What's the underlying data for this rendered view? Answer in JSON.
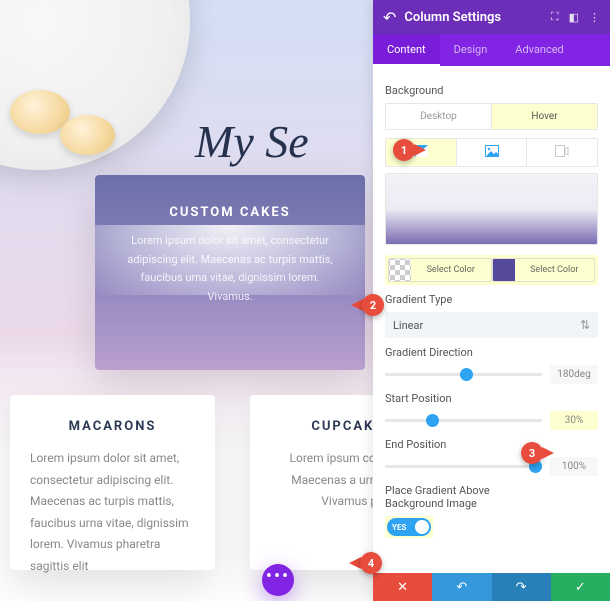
{
  "page": {
    "heading": "My Se",
    "cards": {
      "custom_cakes": {
        "title": "CUSTOM CAKES",
        "body": "Lorem ipsum dolor sit amet, consectetur adipiscing elit. Maecenas ac turpis mattis, faucibus urna vitae, dignissim lorem. Vivamus."
      },
      "macarons": {
        "title": "MACARONS",
        "body": "Lorem ipsum dolor sit amet, consectetur adipiscing elit. Maecenas ac turpis mattis, faucibus urna vitae, dignissim lorem. Vivamus pharetra sagittis elit"
      },
      "cupcakes": {
        "title": "CUPCAKES",
        "body": "Lorem ipsum consectet Maecenas a urna vitae, Vivamus ph"
      }
    },
    "fab": "•••"
  },
  "panel": {
    "title": "Column Settings",
    "tabs": {
      "content": "Content",
      "design": "Design",
      "advanced": "Advanced"
    },
    "background_label": "Background",
    "device_tabs": {
      "desktop": "Desktop",
      "hover": "Hover"
    },
    "select_color": "Select Color",
    "gradient_type": {
      "label": "Gradient Type",
      "value": "Linear"
    },
    "gradient_direction": {
      "label": "Gradient Direction",
      "value": "180deg"
    },
    "start_position": {
      "label": "Start Position",
      "value": "30%"
    },
    "end_position": {
      "label": "End Position",
      "value": "100%"
    },
    "place_above": {
      "label1": "Place Gradient Above",
      "label2": "Background Image",
      "toggle": "YES"
    }
  },
  "callouts": {
    "c1": "1",
    "c2": "2",
    "c3": "3",
    "c4": "4"
  }
}
